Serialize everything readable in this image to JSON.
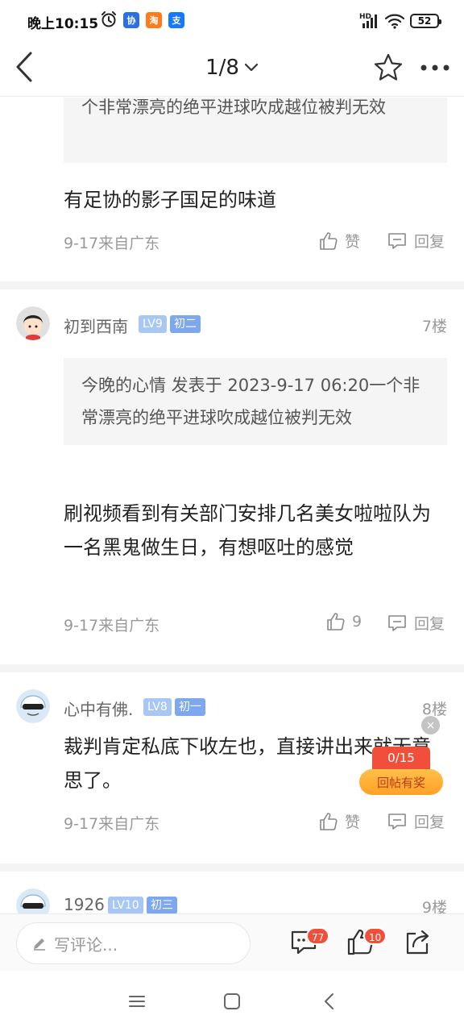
{
  "status_bar": {
    "time": "晚上10:15",
    "app_badges": [
      "协",
      "淘",
      "支"
    ],
    "network": "HD",
    "battery": "52"
  },
  "nav": {
    "page_indicator": "1/8"
  },
  "posts": [
    {
      "quote": "个非常漂亮的绝平进球吹成越位被判无效",
      "body": "有足协的影子国足的味道",
      "meta": "9-17来自广东",
      "like_label": "赞",
      "reply_label": "回复"
    },
    {
      "user": "初到西南",
      "level": "LV9",
      "rank": "初二",
      "floor": "7楼",
      "quote": "今晚的心情 发表于 2023-9-17 06:20一个非常漂亮的绝平进球吹成越位被判无效",
      "body": "刷视频看到有关部门安排几名美女啦啦队为一名黑鬼做生日，有想呕吐的感觉",
      "meta": "9-17来自广东",
      "like_label": "9",
      "reply_label": "回复"
    },
    {
      "user": "心中有佛.",
      "level": "LV8",
      "rank": "初一",
      "floor": "8楼",
      "body": "裁判肯定私底下收左也，直接讲出来就无意思了。",
      "meta": "9-17来自广东",
      "like_label": "赞",
      "reply_label": "回复"
    },
    {
      "user": "1926",
      "level": "LV10",
      "rank": "初三",
      "floor": "9楼"
    }
  ],
  "reward": {
    "close": "×",
    "count": "0/15",
    "label": "回帖有奖"
  },
  "comment_bar": {
    "placeholder": "写评论...",
    "comment_count": "77",
    "like_count": "10"
  },
  "colors": {
    "accent_red": "#f24f3a",
    "level_badge": "#a8c7f5",
    "rank_badge": "#7da7ee"
  }
}
